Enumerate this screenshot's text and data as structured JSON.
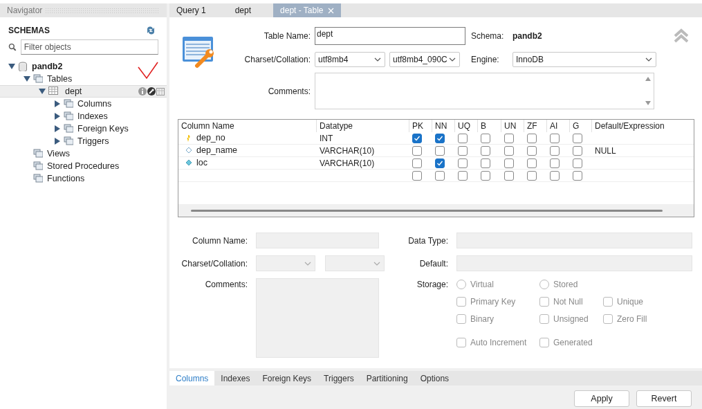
{
  "navigator": {
    "title": "Navigator",
    "section": "SCHEMAS",
    "filter_placeholder": "Filter objects",
    "tree": [
      {
        "label": "pandb2",
        "kind": "schema",
        "expanded": true,
        "selected": false,
        "children": [
          {
            "label": "Tables",
            "kind": "group",
            "expanded": true,
            "selected": false,
            "children": [
              {
                "label": "dept",
                "kind": "table",
                "expanded": true,
                "selected": true,
                "children": [
                  {
                    "label": "Columns",
                    "kind": "group",
                    "expanded": false,
                    "selected": false
                  },
                  {
                    "label": "Indexes",
                    "kind": "group",
                    "expanded": false,
                    "selected": false
                  },
                  {
                    "label": "Foreign Keys",
                    "kind": "group",
                    "expanded": false,
                    "selected": false
                  },
                  {
                    "label": "Triggers",
                    "kind": "group",
                    "expanded": false,
                    "selected": false
                  }
                ]
              }
            ]
          },
          {
            "label": "Views",
            "kind": "group",
            "selected": false
          },
          {
            "label": "Stored Procedures",
            "kind": "group",
            "selected": false
          },
          {
            "label": "Functions",
            "kind": "group",
            "selected": false
          }
        ]
      }
    ]
  },
  "tabs": [
    {
      "label": "Query 1",
      "selected": false,
      "closable": false
    },
    {
      "label": "dept",
      "selected": false,
      "closable": false
    },
    {
      "label": "dept - Table",
      "selected": true,
      "closable": true
    }
  ],
  "editor": {
    "table_name_label": "Table Name:",
    "table_name": "dept",
    "schema_label": "Schema:",
    "schema": "pandb2",
    "charset_label": "Charset/Collation:",
    "charset": "utf8mb4",
    "collation": "utf8mb4_090C",
    "engine_label": "Engine:",
    "engine": "InnoDB",
    "comments_label": "Comments:"
  },
  "grid": {
    "columns": [
      "Column Name",
      "Datatype",
      "PK",
      "NN",
      "UQ",
      "B",
      "UN",
      "ZF",
      "AI",
      "G",
      "Default/Expression"
    ],
    "rows": [
      {
        "kind": "primary",
        "name": "dep_no",
        "datatype": "INT",
        "flags": [
          true,
          true,
          false,
          false,
          false,
          false,
          false,
          false
        ],
        "default": ""
      },
      {
        "kind": "column",
        "name": "dep_name",
        "datatype": "VARCHAR(10)",
        "flags": [
          false,
          false,
          false,
          false,
          false,
          false,
          false,
          false
        ],
        "default": "NULL"
      },
      {
        "kind": "not_null",
        "name": "loc",
        "datatype": "VARCHAR(10)",
        "flags": [
          false,
          true,
          false,
          false,
          false,
          false,
          false,
          false
        ],
        "default": ""
      },
      {
        "kind": "empty",
        "flags": [
          false,
          false,
          false,
          false,
          false,
          false,
          false,
          false
        ]
      }
    ]
  },
  "details": {
    "disabled": true,
    "column_name_label": "Column Name:",
    "charset_label": "Charset/Collation:",
    "comments_label": "Comments:",
    "data_type_label": "Data Type:",
    "default_label": "Default:",
    "storage_label": "Storage:",
    "options": [
      [
        {
          "kind": "radio",
          "label": "Virtual",
          "checked": false
        },
        {
          "kind": "radio",
          "label": "Stored",
          "checked": false
        }
      ],
      [
        {
          "kind": "checkbox",
          "label": "Primary Key",
          "checked": false
        },
        {
          "kind": "checkbox",
          "label": "Not Null",
          "checked": false
        },
        {
          "kind": "checkbox",
          "label": "Unique",
          "checked": false
        }
      ],
      [
        {
          "kind": "checkbox",
          "label": "Binary",
          "checked": false
        },
        {
          "kind": "checkbox",
          "label": "Unsigned",
          "checked": false
        },
        {
          "kind": "checkbox",
          "label": "Zero Fill",
          "checked": false
        }
      ],
      [
        {
          "kind": "checkbox",
          "label": "Auto Increment",
          "checked": false
        },
        {
          "kind": "checkbox",
          "label": "Generated",
          "checked": false
        }
      ]
    ]
  },
  "bottom_tabs": [
    {
      "label": "Columns",
      "selected": true
    },
    {
      "label": "Indexes",
      "selected": false
    },
    {
      "label": "Foreign Keys",
      "selected": false
    },
    {
      "label": "Triggers",
      "selected": false
    },
    {
      "label": "Partitioning",
      "selected": false
    },
    {
      "label": "Options",
      "selected": false
    }
  ],
  "buttons": [
    "Apply",
    "Revert"
  ]
}
